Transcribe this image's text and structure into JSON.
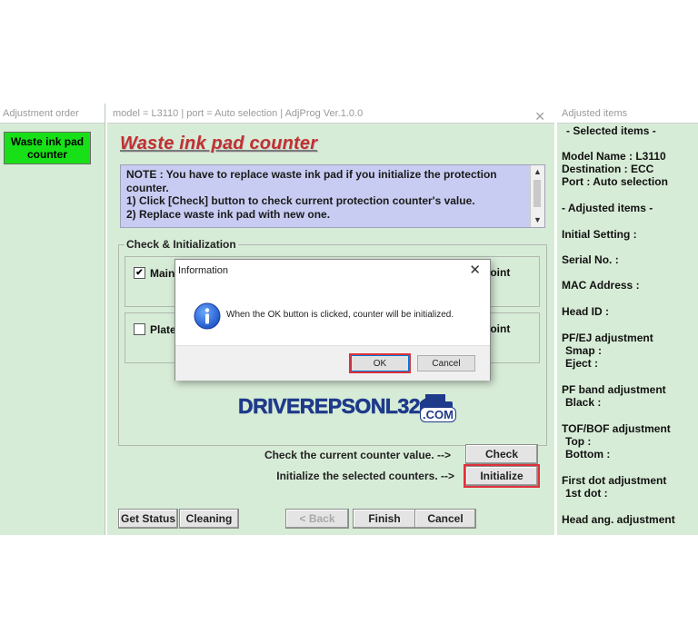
{
  "left_panel": {
    "title": "Adjustment order",
    "item": "Waste ink pad counter"
  },
  "center_panel": {
    "title": "model = L3110 | port = Auto selection | AdjProg Ver.1.0.0",
    "close_glyph": "✕",
    "heading": "Waste ink pad counter",
    "note_lines": [
      "NOTE : You have to replace waste ink pad if you initialize the protection",
      "counter.",
      "1) Click [Check] button to check current protection counter's value.",
      "2) Replace waste ink pad with new one."
    ],
    "group_label": "Check & Initialization",
    "rows": [
      {
        "label": "Main",
        "checked": true,
        "check_glyph": "✔",
        "suffix": "point"
      },
      {
        "label": "Plate",
        "checked": false,
        "check_glyph": "",
        "suffix": "point"
      }
    ],
    "check_text": "Check the current counter value. -->",
    "check_button": "Check",
    "initialize_text": "Initialize the selected counters. -->",
    "initialize_button": "Initialize",
    "bottom_buttons": {
      "get_status": "Get Status",
      "cleaning": "Cleaning",
      "back": "< Back",
      "finish": "Finish",
      "cancel": "Cancel"
    }
  },
  "right_panel": {
    "title": "Adjusted items",
    "lines": [
      "- Selected items -",
      "Model Name : L3110",
      "Destination : ECC",
      "Port : Auto selection",
      "- Adjusted items -",
      "Initial Setting :",
      "Serial No. :",
      "MAC Address :",
      "Head ID :",
      "PF/EJ adjustment",
      "Smap :",
      "Eject :",
      "PF band adjustment",
      "Black :",
      "TOF/BOF adjustment",
      "Top :",
      "Bottom :",
      "First dot adjustment",
      "1st dot :",
      "Head ang. adjustment"
    ]
  },
  "dialog": {
    "title": "Information",
    "close_glyph": "✕",
    "icon": "info-icon",
    "message": "When the OK button is clicked, counter will be initialized.",
    "ok": "OK",
    "cancel": "Cancel"
  },
  "watermark": {
    "text": "DRIVEREPSONL3210",
    "suffix": ".COM"
  },
  "colors": {
    "panel_green": "#d7ecd7",
    "selected_item_green": "#18e018",
    "heading_red": "#c03030",
    "note_blue": "#c8ccf2",
    "highlight_red": "#e0303a",
    "watermark_blue": "#1e3a8a"
  }
}
